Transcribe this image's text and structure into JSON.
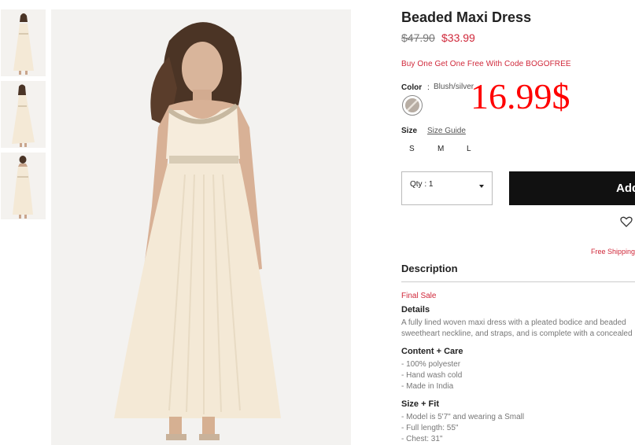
{
  "product": {
    "title": "Beaded Maxi Dress",
    "price_original": "$47.90",
    "price_sale": "$33.99",
    "promo": "Buy One Get One Free With Code BOGOFREE",
    "overlay_price": "16.99$"
  },
  "color": {
    "label": "Color",
    "separator": ":",
    "value": "Blush/silver"
  },
  "size": {
    "label": "Size",
    "guide_label": "Size Guide",
    "options": [
      "S",
      "M",
      "L"
    ]
  },
  "cart": {
    "qty_label": "Qty : 1",
    "add_label": "Add"
  },
  "shipping_text": "Free Shipping",
  "description": {
    "heading": "Description",
    "final_sale": "Final Sale",
    "details_heading": "Details",
    "details_line1": "A fully lined woven maxi dress with a pleated bodice and beaded",
    "details_line2": "sweetheart neckline, and straps, and is complete with a concealed",
    "content_heading": "Content + Care",
    "content_items": [
      "- 100% polyester",
      "- Hand wash cold",
      "- Made in India"
    ],
    "fit_heading": "Size + Fit",
    "fit_items": [
      "- Model is 5'7\" and wearing a Small",
      "- Full length: 55\"",
      "- Chest: 31\""
    ]
  },
  "icons": {
    "wishlist": "heart-icon",
    "dropdown": "chevron-down-icon"
  },
  "colors": {
    "sale_red": "#d0283a",
    "overlay_red": "#ff0000",
    "button_black": "#111111",
    "dress_cream": "#f4e9d6"
  }
}
